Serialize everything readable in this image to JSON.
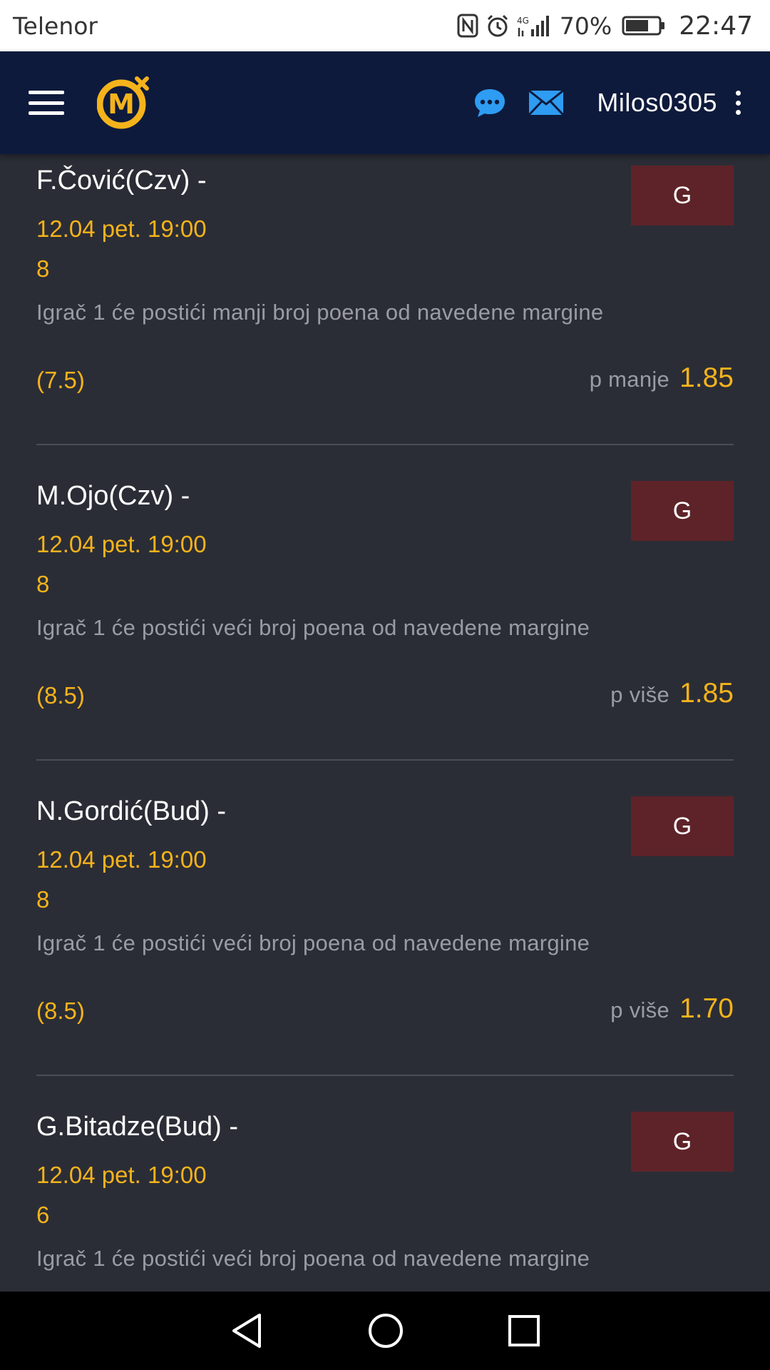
{
  "status_bar": {
    "carrier": "Telenor",
    "network": "4G",
    "battery_percent": "70%",
    "battery_level": 0.7,
    "time": "22:47"
  },
  "header": {
    "logo_letter": "M",
    "username": "Milos0305",
    "colors": {
      "background": "#0e1a3c",
      "accent": "#f5b31b",
      "icon_blue": "#2e9cf2"
    }
  },
  "bets": [
    {
      "player": "F.Čović(Czv) -",
      "button": "G",
      "datetime": "12.04 pet. 19:00",
      "code": "8",
      "description": "Igrač 1 će postići manji broj poena od navedene margine",
      "margin": "(7.5)",
      "odd_type": "p manje",
      "odd_value": "1.85"
    },
    {
      "player": "M.Ojo(Czv) -",
      "button": "G",
      "datetime": "12.04 pet. 19:00",
      "code": "8",
      "description": "Igrač 1 će postići veći broj poena od navedene margine",
      "margin": "(8.5)",
      "odd_type": "p više",
      "odd_value": "1.85"
    },
    {
      "player": "N.Gordić(Bud) -",
      "button": "G",
      "datetime": "12.04 pet. 19:00",
      "code": "8",
      "description": "Igrač 1 će postići veći broj poena od navedene margine",
      "margin": "(8.5)",
      "odd_type": "p više",
      "odd_value": "1.70"
    },
    {
      "player": "G.Bitadze(Bud) -",
      "button": "G",
      "datetime": "12.04 pet. 19:00",
      "code": "6",
      "description": "Igrač 1 će postići veći broj poena od navedene margine",
      "margin": "",
      "odd_type": "",
      "odd_value": ""
    }
  ],
  "icons": {
    "status": [
      "nfc-icon",
      "alarm-icon",
      "signal-icon",
      "battery-icon"
    ],
    "header": [
      "menu-icon",
      "logo-icon",
      "chat-icon",
      "mail-icon",
      "more-vert-icon"
    ],
    "nav": [
      "back-icon",
      "home-icon",
      "recents-icon"
    ]
  }
}
